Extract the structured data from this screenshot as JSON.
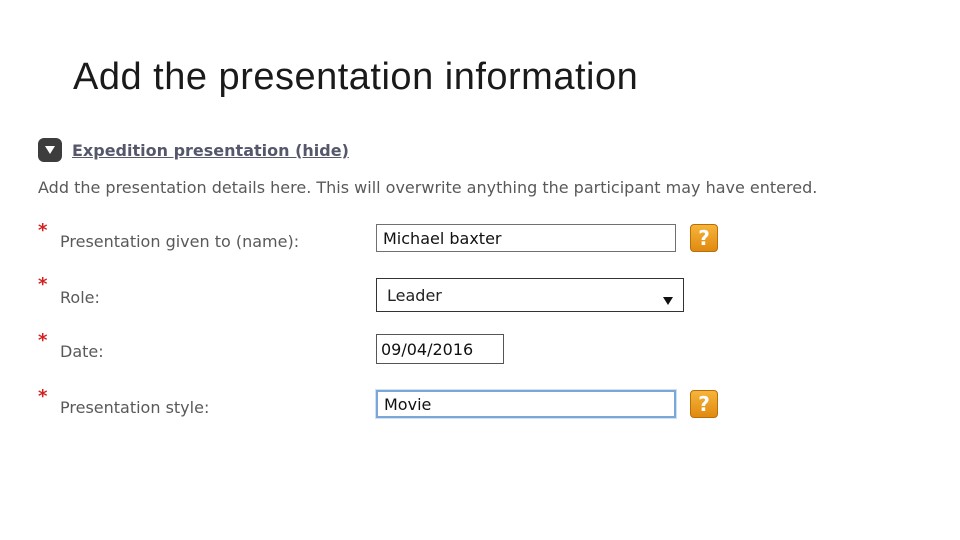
{
  "slide": {
    "title": "Add the presentation information"
  },
  "section": {
    "title": "Expedition presentation (hide)",
    "instructions": "Add the presentation details here. This will overwrite anything the participant may have entered."
  },
  "form": {
    "required_marker": "*",
    "help_glyph": "?",
    "fields": {
      "name": {
        "label": "Presentation given to (name):",
        "value": "Michael baxter"
      },
      "role": {
        "label": "Role:",
        "value": "Leader"
      },
      "date": {
        "label": "Date:",
        "value": "09/04/2016"
      },
      "style": {
        "label": "Presentation style:",
        "value": "Movie"
      }
    }
  },
  "colors": {
    "section_title": "#55576b",
    "label_text": "#595959",
    "required": "#d62020",
    "help_icon": "#f0a020",
    "focus_border": "#7aa7d8"
  },
  "icons": {
    "toggle": "collapse-triangle-icon",
    "help": "question-mark-icon",
    "select_arrow": "dropdown-arrow-icon"
  }
}
